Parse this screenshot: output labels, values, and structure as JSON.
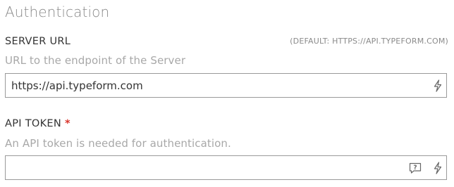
{
  "section": {
    "title": "Authentication"
  },
  "server_url": {
    "label": "SERVER URL",
    "default_hint": "(DEFAULT: HTTPS://API.TYPEFORM.COM)",
    "help": "URL to the endpoint of the Server",
    "value": "https://api.typeform.com",
    "icons": [
      "lightning-icon"
    ]
  },
  "api_token": {
    "label": "API TOKEN",
    "required_marker": "*",
    "help": "An API token is needed for authentication.",
    "value": "",
    "icons": [
      "help-comment-icon",
      "lightning-icon"
    ]
  }
}
